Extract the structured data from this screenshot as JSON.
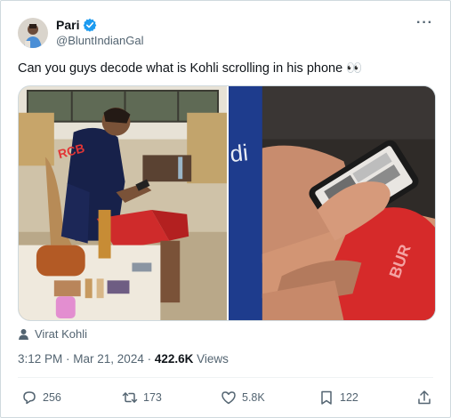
{
  "author": {
    "name": "Pari",
    "handle": "@BluntIndianGal"
  },
  "more_icon": "more-horizontal-icon",
  "tweet": {
    "text": "Can you guys decode what is Kohli scrolling in his phone 👀"
  },
  "media": [
    {
      "description_icon": "photo-man-sitting-on-chair"
    },
    {
      "description_icon": "photo-closeup-hands-phone"
    }
  ],
  "tag": {
    "icon": "person-icon",
    "label": "Virat Kohli"
  },
  "meta": {
    "time": "3:12 PM",
    "separator1": " · ",
    "date": "Mar 21, 2024",
    "separator2": " · ",
    "views_count": "422.6K",
    "views_label": " Views"
  },
  "actions": {
    "reply_count": "256",
    "retweet_count": "173",
    "like_count": "5.8K",
    "bookmark_count": "122"
  },
  "colors": {
    "verified": "#1d9bf0",
    "muted": "#536471",
    "text": "#0f1419"
  }
}
